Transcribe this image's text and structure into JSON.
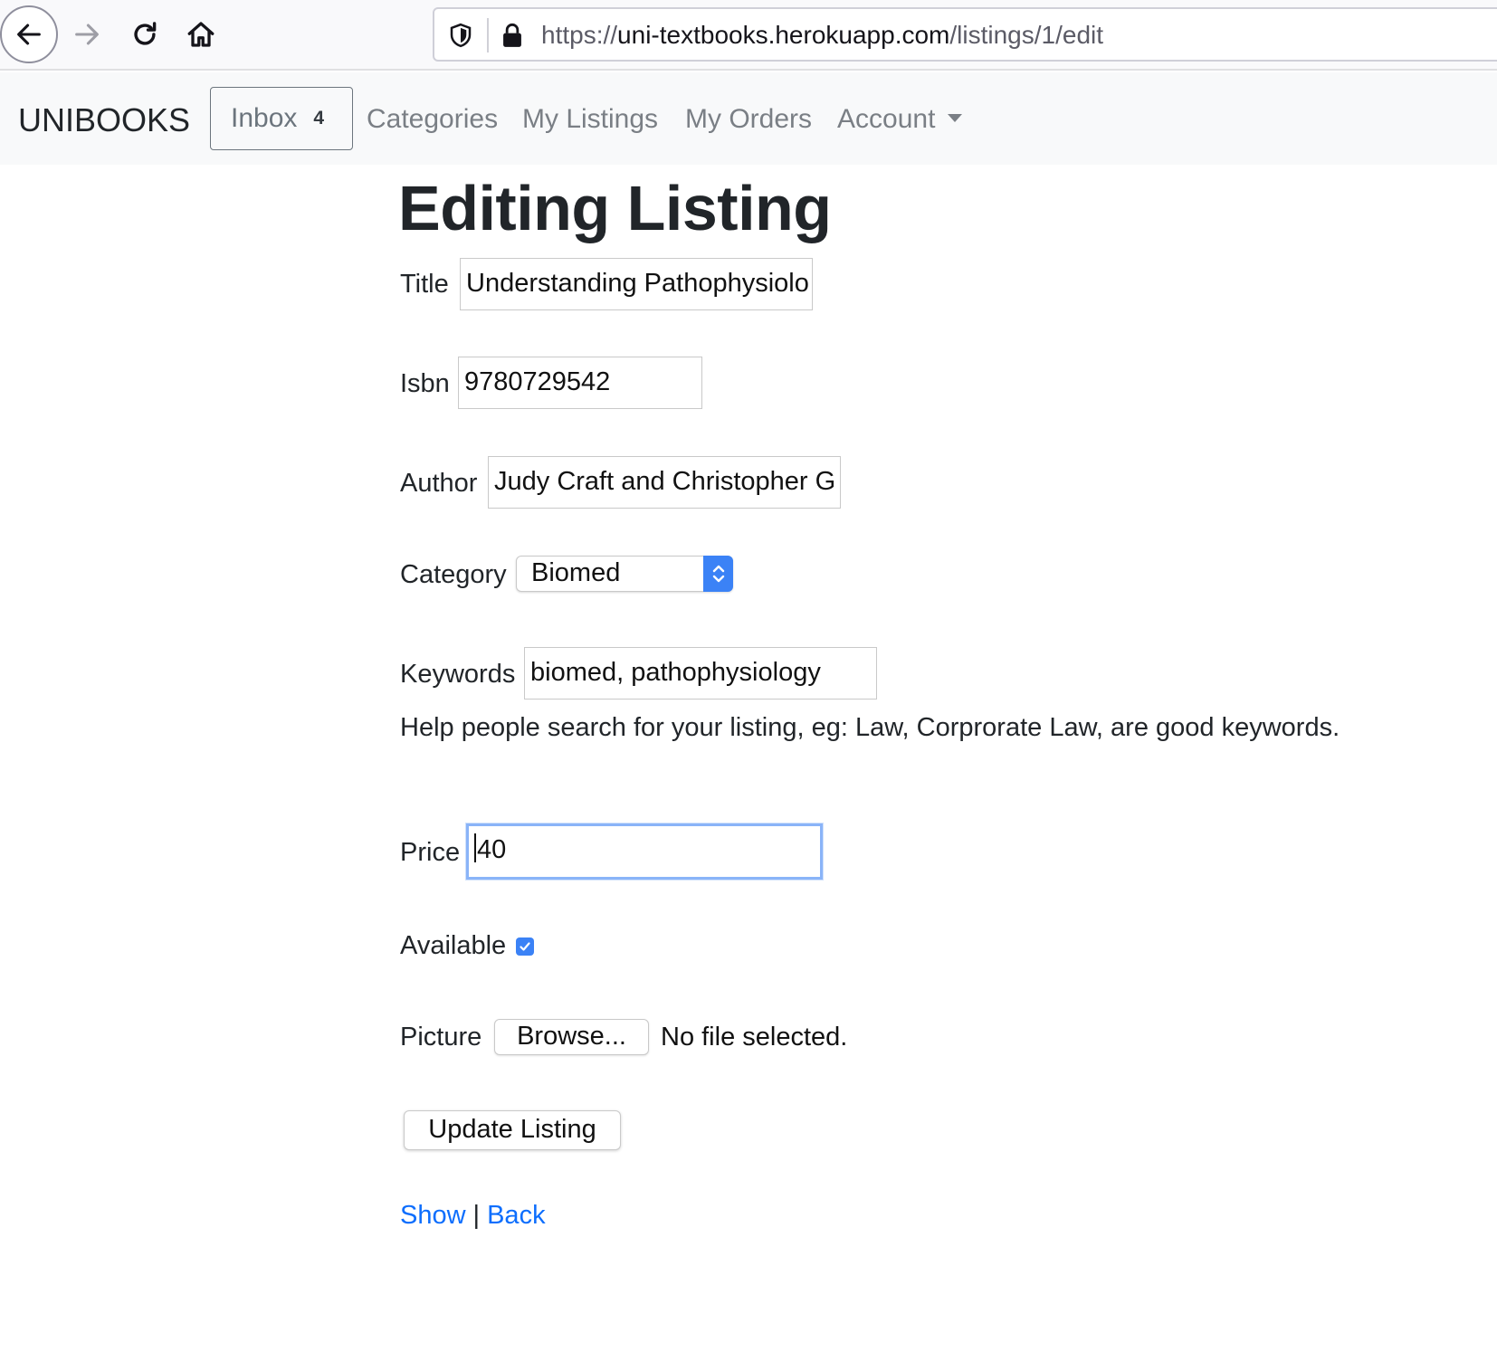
{
  "browser": {
    "url_scheme": "https://",
    "url_host": "uni-textbooks.herokuapp.com",
    "url_path": "/listings/1/edit"
  },
  "navbar": {
    "brand": "UNIBOOKS",
    "inbox_label": "Inbox",
    "inbox_count": "4",
    "links": [
      "Categories",
      "My Listings",
      "My Orders",
      "Account"
    ]
  },
  "form": {
    "heading": "Editing Listing",
    "title_label": "Title",
    "title_value": "Understanding Pathophysiolo",
    "isbn_label": "Isbn",
    "isbn_value": "9780729542",
    "author_label": "Author",
    "author_value": "Judy Craft and Christopher G",
    "category_label": "Category",
    "category_value": "Biomed",
    "keywords_label": "Keywords",
    "keywords_value": "biomed, pathophysiology",
    "keywords_help": "Help people search for your listing, eg: Law, Corprorate Law, are good keywords.",
    "price_label": "Price",
    "price_value": "40",
    "available_label": "Available",
    "available_checked": true,
    "picture_label": "Picture",
    "browse_label": "Browse...",
    "file_status": "No file selected.",
    "submit_label": "Update Listing"
  },
  "footer_links": {
    "show": "Show",
    "separator": "|",
    "back": "Back"
  },
  "colors": {
    "link": "#0d6efd",
    "nav_text": "#7a7f85",
    "focus": "#8ab4f8",
    "control_accent": "#3b82f6"
  }
}
